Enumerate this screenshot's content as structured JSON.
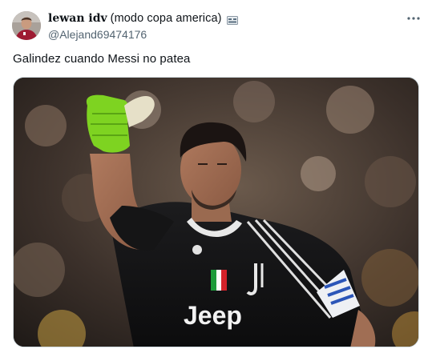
{
  "tweet": {
    "author": {
      "display_name": "lewan idv",
      "nickname": "(modo copa america)",
      "handle": "@Alejand69474176",
      "name_emoji_icon": "flag-emoji-icon",
      "avatar_icon": "profile-avatar"
    },
    "more_icon": "more-horizontal-icon",
    "text": "Galindez cuando Messi no patea",
    "media": {
      "jersey_sponsor": "Jeep",
      "subject": "goalkeeper-thumbs-up-photo"
    }
  }
}
